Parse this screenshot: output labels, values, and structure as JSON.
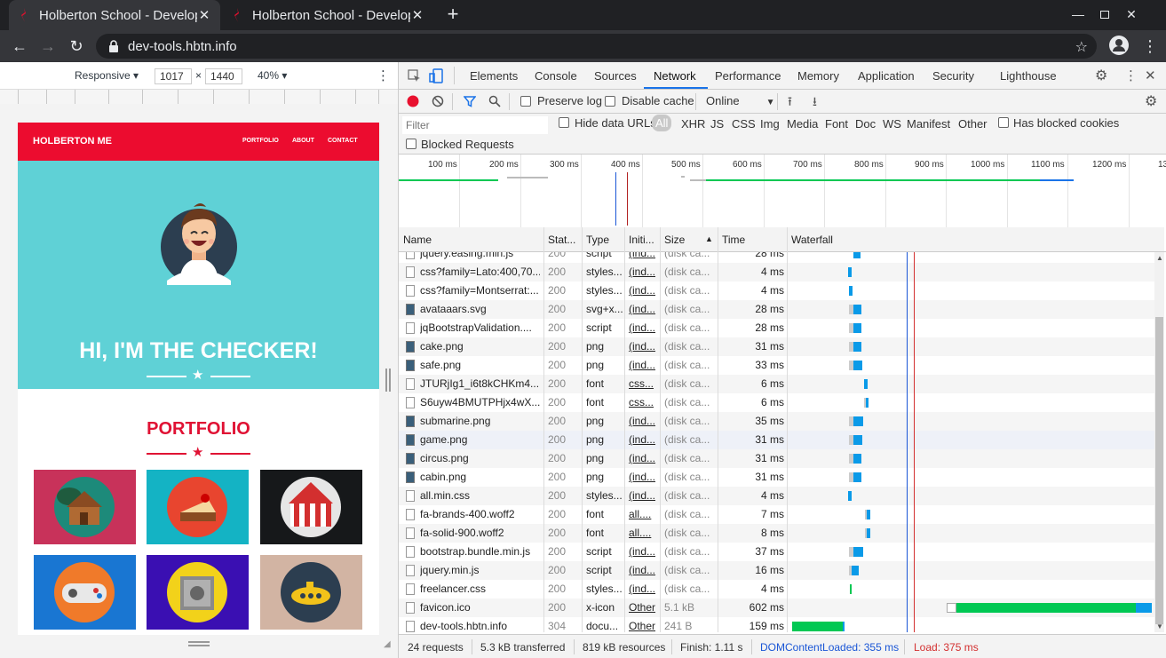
{
  "browser": {
    "tabs": [
      {
        "title": "Holberton School - Develop",
        "active": true
      },
      {
        "title": "Holberton School - Develop",
        "active": false
      }
    ],
    "url": "dev-tools.hbtn.info",
    "colors": {
      "frame": "#202124",
      "toolbar": "#35363a",
      "text": "#e8eaed",
      "favicon": "#e0102e"
    }
  },
  "device_toolbar": {
    "mode": "Responsive",
    "width": "1017",
    "times": "×",
    "height": "1440",
    "zoom": "40%"
  },
  "mobile_page": {
    "brand": "HOLBERTON ME",
    "nav": [
      "PORTFOLIO",
      "ABOUT",
      "CONTACT"
    ],
    "hero_title": "HI, I'M THE CHECKER!",
    "portfolio_title": "PORTFOLIO",
    "colors": {
      "nav": "#ec0c2f",
      "hero": "#5fd1d6",
      "accent": "#e01234"
    },
    "tiles": [
      {
        "icon": "cabin-icon",
        "bg": "#c8325a"
      },
      {
        "icon": "cake-icon",
        "bg": "#14b3c4"
      },
      {
        "icon": "circus-icon",
        "bg": "#16181a"
      },
      {
        "icon": "game-icon",
        "bg": "#1976d2"
      },
      {
        "icon": "safe-icon",
        "bg": "#3a0fb2"
      },
      {
        "icon": "submarine-icon",
        "bg": "#d2b4a3"
      }
    ]
  },
  "devtools": {
    "tabs": [
      "Elements",
      "Console",
      "Sources",
      "Network",
      "Performance",
      "Memory",
      "Application",
      "Security",
      "Lighthouse"
    ],
    "active_tab": "Network",
    "net_toolbar": {
      "preserve_log": "Preserve log",
      "disable_cache": "Disable cache",
      "throttle": "Online"
    },
    "filter": {
      "placeholder": "Filter",
      "hide_data_urls": "Hide data URLs",
      "types": [
        "All",
        "XHR",
        "JS",
        "CSS",
        "Img",
        "Media",
        "Font",
        "Doc",
        "WS",
        "Manifest",
        "Other"
      ],
      "has_blocked_cookies": "Has blocked cookies",
      "blocked_requests": "Blocked Requests"
    },
    "overview_ticks": [
      "100 ms",
      "200 ms",
      "300 ms",
      "400 ms",
      "500 ms",
      "600 ms",
      "700 ms",
      "800 ms",
      "900 ms",
      "1000 ms",
      "1100 ms",
      "1200 ms",
      "13"
    ],
    "columns": [
      "Name",
      "Stat...",
      "Type",
      "Initi...",
      "Size",
      "Time",
      "Waterfall"
    ],
    "partial_row": {
      "name": "jquery.easing.min.js",
      "status": "200",
      "type": "script",
      "initiator": "(ind...",
      "size": "(disk ca...",
      "time": "28 ms"
    },
    "rows": [
      {
        "name": "css?family=Lato:400,70...",
        "status": "200",
        "type": "styles...",
        "initiator": "(ind...",
        "size": "(disk ca...",
        "time": "4 ms",
        "icon": "file-icon"
      },
      {
        "name": "css?family=Montserrat:...",
        "status": "200",
        "type": "styles...",
        "initiator": "(ind...",
        "size": "(disk ca...",
        "time": "4 ms",
        "icon": "file-icon"
      },
      {
        "name": "avataaars.svg",
        "status": "200",
        "type": "svg+x...",
        "initiator": "(ind...",
        "size": "(disk ca...",
        "time": "28 ms",
        "icon": "image-icon"
      },
      {
        "name": "jqBootstrapValidation....",
        "status": "200",
        "type": "script",
        "initiator": "(ind...",
        "size": "(disk ca...",
        "time": "28 ms",
        "icon": "file-icon"
      },
      {
        "name": "cake.png",
        "status": "200",
        "type": "png",
        "initiator": "(ind...",
        "size": "(disk ca...",
        "time": "31 ms",
        "icon": "image-icon"
      },
      {
        "name": "safe.png",
        "status": "200",
        "type": "png",
        "initiator": "(ind...",
        "size": "(disk ca...",
        "time": "33 ms",
        "icon": "image-icon"
      },
      {
        "name": "JTURjIg1_i6t8kCHKm4...",
        "status": "200",
        "type": "font",
        "initiator": "css...",
        "size": "(disk ca...",
        "time": "6 ms",
        "icon": "file-icon"
      },
      {
        "name": "S6uyw4BMUTPHjx4wX...",
        "status": "200",
        "type": "font",
        "initiator": "css...",
        "size": "(disk ca...",
        "time": "6 ms",
        "icon": "file-icon"
      },
      {
        "name": "submarine.png",
        "status": "200",
        "type": "png",
        "initiator": "(ind...",
        "size": "(disk ca...",
        "time": "35 ms",
        "icon": "image-icon"
      },
      {
        "name": "game.png",
        "status": "200",
        "type": "png",
        "initiator": "(ind...",
        "size": "(disk ca...",
        "time": "31 ms",
        "icon": "image-icon"
      },
      {
        "name": "circus.png",
        "status": "200",
        "type": "png",
        "initiator": "(ind...",
        "size": "(disk ca...",
        "time": "31 ms",
        "icon": "image-icon"
      },
      {
        "name": "cabin.png",
        "status": "200",
        "type": "png",
        "initiator": "(ind...",
        "size": "(disk ca...",
        "time": "31 ms",
        "icon": "image-icon"
      },
      {
        "name": "all.min.css",
        "status": "200",
        "type": "styles...",
        "initiator": "(ind...",
        "size": "(disk ca...",
        "time": "4 ms",
        "icon": "file-icon"
      },
      {
        "name": "fa-brands-400.woff2",
        "status": "200",
        "type": "font",
        "initiator": "all....",
        "size": "(disk ca...",
        "time": "7 ms",
        "icon": "file-icon"
      },
      {
        "name": "fa-solid-900.woff2",
        "status": "200",
        "type": "font",
        "initiator": "all....",
        "size": "(disk ca...",
        "time": "8 ms",
        "icon": "file-icon"
      },
      {
        "name": "bootstrap.bundle.min.js",
        "status": "200",
        "type": "script",
        "initiator": "(ind...",
        "size": "(disk ca...",
        "time": "37 ms",
        "icon": "file-icon"
      },
      {
        "name": "jquery.min.js",
        "status": "200",
        "type": "script",
        "initiator": "(ind...",
        "size": "(disk ca...",
        "time": "16 ms",
        "icon": "file-icon"
      },
      {
        "name": "freelancer.css",
        "status": "200",
        "type": "styles...",
        "initiator": "(ind...",
        "size": "(disk ca...",
        "time": "4 ms",
        "icon": "file-icon"
      },
      {
        "name": "favicon.ico",
        "status": "200",
        "type": "x-icon",
        "initiator": "Other",
        "size": "5.1 kB",
        "time": "602 ms",
        "icon": "file-icon"
      },
      {
        "name": "dev-tools.hbtn.info",
        "status": "304",
        "type": "docu...",
        "initiator": "Other",
        "size": "241 B",
        "time": "159 ms",
        "icon": "file-icon"
      }
    ],
    "status": {
      "requests": "24 requests",
      "transferred": "5.3 kB transferred",
      "resources": "819 kB resources",
      "finish": "Finish: 1.11 s",
      "dcl": "DOMContentLoaded: 355 ms",
      "load": "Load: 375 ms"
    },
    "colors": {
      "dcl": "#1a56d6",
      "load": "#d33030",
      "waiting": "#00c853",
      "download": "#0a9ae8",
      "record": "#e8102e"
    }
  }
}
